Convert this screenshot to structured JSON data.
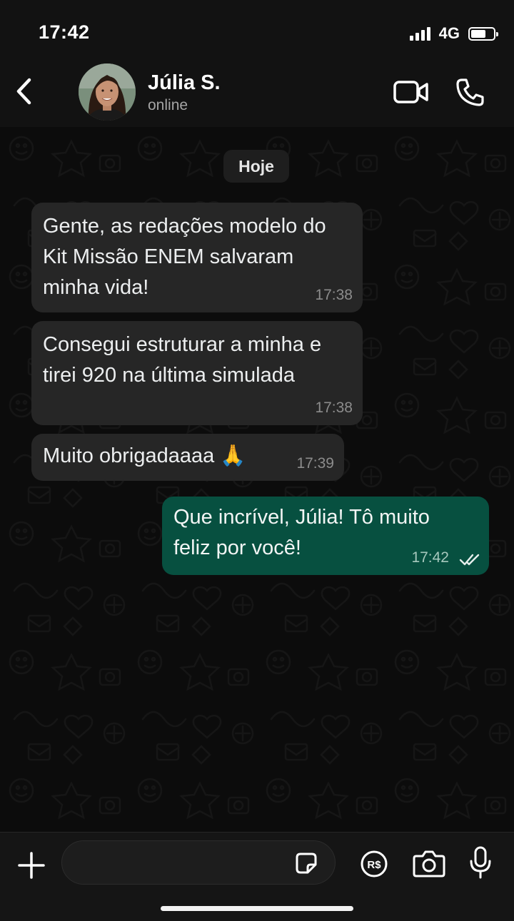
{
  "status_bar": {
    "time": "17:42",
    "network": "4G",
    "battery_level": 0.72
  },
  "header": {
    "contact_name": "Júlia S.",
    "contact_status": "online",
    "icons": {
      "back": "chevron-left-icon",
      "video": "video-camera-icon",
      "call": "phone-icon"
    }
  },
  "chat": {
    "date_chip": "Hoje",
    "messages": [
      {
        "direction": "incoming",
        "lines": [
          "Gente, as redações modelo do",
          "Kit Missão ENEM salvaram",
          "minha vida!"
        ],
        "time": "17:38"
      },
      {
        "direction": "incoming",
        "lines": [
          "Consegui estruturar a minha e",
          "tirei 920 na última simulada"
        ],
        "time": "17:38"
      },
      {
        "direction": "incoming",
        "lines": [
          "Muito obrigadaaaa 🙏"
        ],
        "time": "17:39"
      },
      {
        "direction": "outgoing",
        "lines": [
          "Que incrível, Júlia! Tô muito",
          "feliz por você!"
        ],
        "time": "17:42",
        "status": "read"
      }
    ]
  },
  "input_bar": {
    "message_value": "",
    "icons": {
      "plus": "plus-icon",
      "sticker": "sticker-icon",
      "payment": "payment-icon",
      "camera": "camera-icon",
      "mic": "microphone-icon"
    },
    "payment_label": "R$"
  },
  "colors": {
    "incoming_bubble": "#262626",
    "outgoing_bubble": "#075040",
    "background": "#0c0c0c"
  }
}
